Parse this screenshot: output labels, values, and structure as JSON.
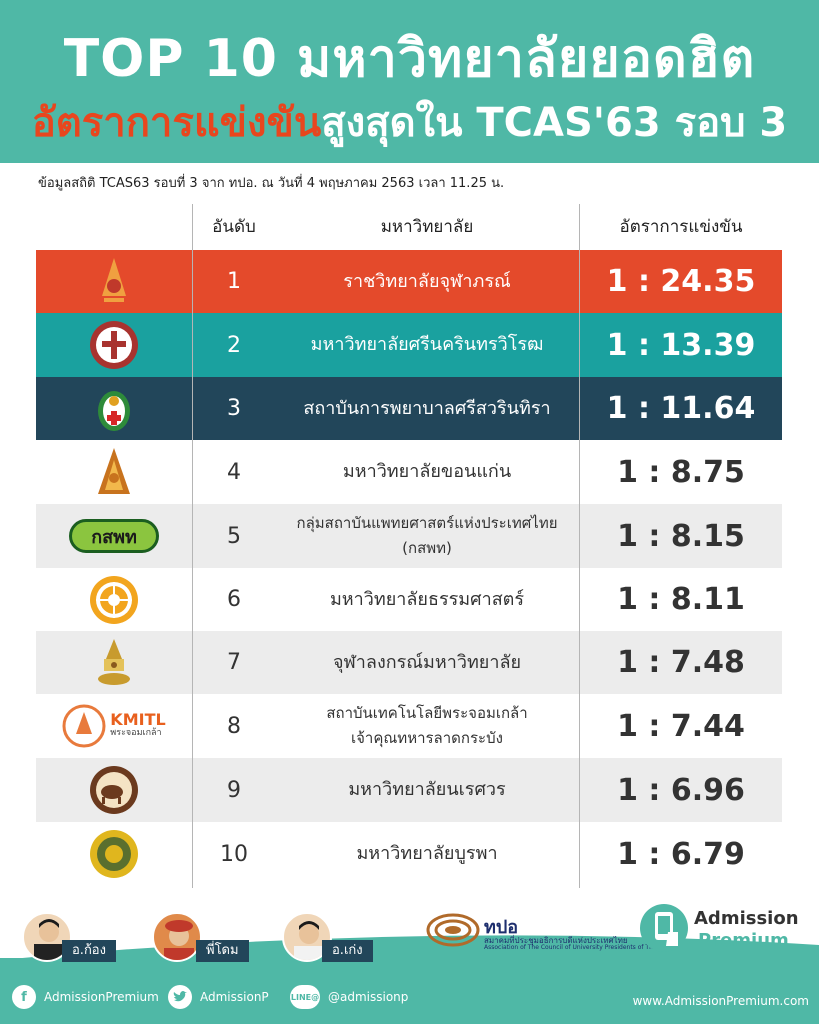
{
  "header": {
    "title_line1": "TOP 10 มหาวิทยาลัยยอดฮิต",
    "title_line2_highlight": "อัตราการแข่งขัน",
    "title_line2_rest": "สูงสุดใน TCAS'63 รอบ 3"
  },
  "source_note": "ข้อมูลสถิติ TCAS63 รอบที่ 3 จาก ทปอ. ณ วันที่ 4 พฤษภาคม 2563 เวลา 11.25 น.",
  "table": {
    "headers": {
      "rank": "อันดับ",
      "university": "มหาวิทยาลัย",
      "ratio": "อัตราการแข่งขัน"
    },
    "rows": [
      {
        "rank": "1",
        "name": "ราชวิทยาลัยจุฬาภรณ์",
        "ratio": "1 : 24.35",
        "logo": "chulabhorn-logo"
      },
      {
        "rank": "2",
        "name": "มหาวิทยาลัยศรีนครินทรวิโรฒ",
        "ratio": "1 : 13.39",
        "logo": "swu-logo"
      },
      {
        "rank": "3",
        "name": "สถาบันการพยาบาลศรีสวรินทิรา",
        "ratio": "1 : 11.64",
        "logo": "srisavarindhira-logo"
      },
      {
        "rank": "4",
        "name": "มหาวิทยาลัยขอนแก่น",
        "ratio": "1 : 8.75",
        "logo": "kku-logo"
      },
      {
        "rank": "5",
        "name_line1": "กลุ่มสถาบันแพทยศาสตร์แห่งประเทศไทย",
        "name_line2": "(กสพท)",
        "ratio": "1 : 8.15",
        "logo": "kspt-logo",
        "logo_text": "กสพท"
      },
      {
        "rank": "6",
        "name": "มหาวิทยาลัยธรรมศาสตร์",
        "ratio": "1 : 8.11",
        "logo": "tu-logo"
      },
      {
        "rank": "7",
        "name": "จุฬาลงกรณ์มหาวิทยาลัย",
        "ratio": "1 : 7.48",
        "logo": "chula-logo"
      },
      {
        "rank": "8",
        "name_line1": "สถาบันเทคโนโลยีพระจอมเกล้า",
        "name_line2": "เจ้าคุณทหารลาดกระบัง",
        "ratio": "1 : 7.44",
        "logo": "kmitl-logo",
        "logo_text": "KMITL",
        "logo_subtext": "พระจอมเกล้า"
      },
      {
        "rank": "9",
        "name": "มหาวิทยาลัยนเรศวร",
        "ratio": "1 : 6.96",
        "logo": "nu-logo"
      },
      {
        "rank": "10",
        "name": "มหาวิทยาลัยบูรพา",
        "ratio": "1 : 6.79",
        "logo": "buu-logo"
      }
    ]
  },
  "tutors": [
    {
      "label": "อ.ก้อง"
    },
    {
      "label": "พี่โดม"
    },
    {
      "label": "อ.เก่ง"
    }
  ],
  "association": {
    "abbr": "ทปอ",
    "name_th": "สมาคมที่ประชุมอธิการบดีแห่งประเทศไทย",
    "name_en": "Association of The Council of University Presidents of Thailand"
  },
  "brand": {
    "line1": "Admission",
    "line2": "Premium"
  },
  "social": {
    "facebook": "AdmissionPremium",
    "twitter": "AdmissionP",
    "line": "@admissionp",
    "line_icon_text": "LINE@",
    "website": "www.AdmissionPremium.com"
  },
  "colors": {
    "teal": "#4fb8a6",
    "highlight_orange": "#e8461e",
    "row1": "#e44a2b",
    "row2": "#1aa19f",
    "row3": "#22465a",
    "stripe": "#ececec"
  }
}
